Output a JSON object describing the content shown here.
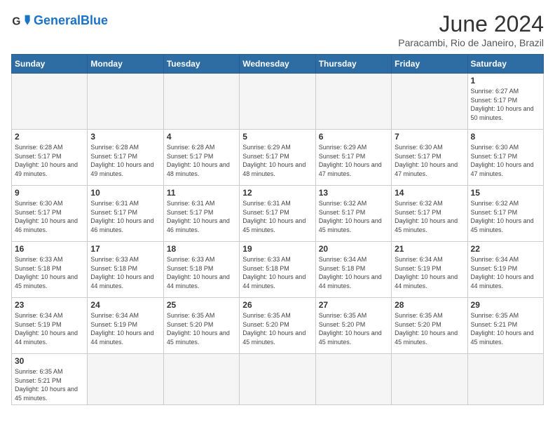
{
  "header": {
    "logo_general": "General",
    "logo_blue": "Blue",
    "month_title": "June 2024",
    "location": "Paracambi, Rio de Janeiro, Brazil"
  },
  "days_of_week": [
    "Sunday",
    "Monday",
    "Tuesday",
    "Wednesday",
    "Thursday",
    "Friday",
    "Saturday"
  ],
  "weeks": [
    [
      {
        "day": "",
        "info": ""
      },
      {
        "day": "",
        "info": ""
      },
      {
        "day": "",
        "info": ""
      },
      {
        "day": "",
        "info": ""
      },
      {
        "day": "",
        "info": ""
      },
      {
        "day": "",
        "info": ""
      },
      {
        "day": "1",
        "info": "Sunrise: 6:27 AM\nSunset: 5:17 PM\nDaylight: 10 hours and 50 minutes."
      }
    ],
    [
      {
        "day": "2",
        "info": "Sunrise: 6:28 AM\nSunset: 5:17 PM\nDaylight: 10 hours and 49 minutes."
      },
      {
        "day": "3",
        "info": "Sunrise: 6:28 AM\nSunset: 5:17 PM\nDaylight: 10 hours and 49 minutes."
      },
      {
        "day": "4",
        "info": "Sunrise: 6:28 AM\nSunset: 5:17 PM\nDaylight: 10 hours and 48 minutes."
      },
      {
        "day": "5",
        "info": "Sunrise: 6:29 AM\nSunset: 5:17 PM\nDaylight: 10 hours and 48 minutes."
      },
      {
        "day": "6",
        "info": "Sunrise: 6:29 AM\nSunset: 5:17 PM\nDaylight: 10 hours and 47 minutes."
      },
      {
        "day": "7",
        "info": "Sunrise: 6:30 AM\nSunset: 5:17 PM\nDaylight: 10 hours and 47 minutes."
      },
      {
        "day": "8",
        "info": "Sunrise: 6:30 AM\nSunset: 5:17 PM\nDaylight: 10 hours and 47 minutes."
      }
    ],
    [
      {
        "day": "9",
        "info": "Sunrise: 6:30 AM\nSunset: 5:17 PM\nDaylight: 10 hours and 46 minutes."
      },
      {
        "day": "10",
        "info": "Sunrise: 6:31 AM\nSunset: 5:17 PM\nDaylight: 10 hours and 46 minutes."
      },
      {
        "day": "11",
        "info": "Sunrise: 6:31 AM\nSunset: 5:17 PM\nDaylight: 10 hours and 46 minutes."
      },
      {
        "day": "12",
        "info": "Sunrise: 6:31 AM\nSunset: 5:17 PM\nDaylight: 10 hours and 45 minutes."
      },
      {
        "day": "13",
        "info": "Sunrise: 6:32 AM\nSunset: 5:17 PM\nDaylight: 10 hours and 45 minutes."
      },
      {
        "day": "14",
        "info": "Sunrise: 6:32 AM\nSunset: 5:17 PM\nDaylight: 10 hours and 45 minutes."
      },
      {
        "day": "15",
        "info": "Sunrise: 6:32 AM\nSunset: 5:17 PM\nDaylight: 10 hours and 45 minutes."
      }
    ],
    [
      {
        "day": "16",
        "info": "Sunrise: 6:33 AM\nSunset: 5:18 PM\nDaylight: 10 hours and 45 minutes."
      },
      {
        "day": "17",
        "info": "Sunrise: 6:33 AM\nSunset: 5:18 PM\nDaylight: 10 hours and 44 minutes."
      },
      {
        "day": "18",
        "info": "Sunrise: 6:33 AM\nSunset: 5:18 PM\nDaylight: 10 hours and 44 minutes."
      },
      {
        "day": "19",
        "info": "Sunrise: 6:33 AM\nSunset: 5:18 PM\nDaylight: 10 hours and 44 minutes."
      },
      {
        "day": "20",
        "info": "Sunrise: 6:34 AM\nSunset: 5:18 PM\nDaylight: 10 hours and 44 minutes."
      },
      {
        "day": "21",
        "info": "Sunrise: 6:34 AM\nSunset: 5:19 PM\nDaylight: 10 hours and 44 minutes."
      },
      {
        "day": "22",
        "info": "Sunrise: 6:34 AM\nSunset: 5:19 PM\nDaylight: 10 hours and 44 minutes."
      }
    ],
    [
      {
        "day": "23",
        "info": "Sunrise: 6:34 AM\nSunset: 5:19 PM\nDaylight: 10 hours and 44 minutes."
      },
      {
        "day": "24",
        "info": "Sunrise: 6:34 AM\nSunset: 5:19 PM\nDaylight: 10 hours and 44 minutes."
      },
      {
        "day": "25",
        "info": "Sunrise: 6:35 AM\nSunset: 5:20 PM\nDaylight: 10 hours and 45 minutes."
      },
      {
        "day": "26",
        "info": "Sunrise: 6:35 AM\nSunset: 5:20 PM\nDaylight: 10 hours and 45 minutes."
      },
      {
        "day": "27",
        "info": "Sunrise: 6:35 AM\nSunset: 5:20 PM\nDaylight: 10 hours and 45 minutes."
      },
      {
        "day": "28",
        "info": "Sunrise: 6:35 AM\nSunset: 5:20 PM\nDaylight: 10 hours and 45 minutes."
      },
      {
        "day": "29",
        "info": "Sunrise: 6:35 AM\nSunset: 5:21 PM\nDaylight: 10 hours and 45 minutes."
      }
    ],
    [
      {
        "day": "30",
        "info": "Sunrise: 6:35 AM\nSunset: 5:21 PM\nDaylight: 10 hours and 45 minutes."
      },
      {
        "day": "",
        "info": ""
      },
      {
        "day": "",
        "info": ""
      },
      {
        "day": "",
        "info": ""
      },
      {
        "day": "",
        "info": ""
      },
      {
        "day": "",
        "info": ""
      },
      {
        "day": "",
        "info": ""
      }
    ]
  ]
}
